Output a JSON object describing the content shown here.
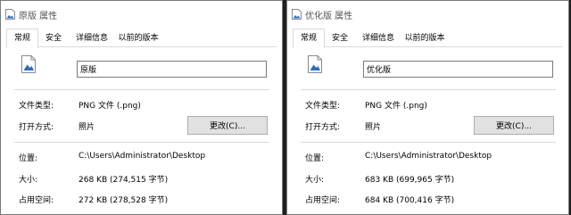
{
  "dialogs": [
    {
      "title": "原版 属性",
      "tabs": [
        "常规",
        "安全",
        "详细信息",
        "以前的版本"
      ],
      "file_name": "原版",
      "file_type_label": "文件类型:",
      "file_type_value": "PNG 文件 (.png)",
      "open_with_label": "打开方式:",
      "open_with_value": "照片",
      "change_button": "更改(C)...",
      "location_label": "位置:",
      "location_value": "C:\\Users\\Administrator\\Desktop",
      "size_label": "大小:",
      "size_value": "268 KB (274,515 字节)",
      "disk_label": "占用空间:",
      "disk_value": "272 KB (278,528 字节)"
    },
    {
      "title": "优化版 属性",
      "tabs": [
        "常规",
        "安全",
        "详细信息",
        "以前的版本"
      ],
      "file_name": "优化版",
      "file_type_label": "文件类型:",
      "file_type_value": "PNG 文件 (.png)",
      "open_with_label": "打开方式:",
      "open_with_value": "照片",
      "change_button": "更改(C)...",
      "location_label": "位置:",
      "location_value": "C:\\Users\\Administrator\\Desktop",
      "size_label": "大小:",
      "size_value": "683 KB (699,965 字节)",
      "disk_label": "占用空间:",
      "disk_value": "684 KB (700,416 字节)"
    }
  ],
  "colors": {
    "icon_blue": "#2b6cc4",
    "tab_border": "#d9d9d9",
    "button_bg": "#e1e1e1"
  },
  "icons": {
    "title": "image-file-icon",
    "file": "image-file-icon"
  }
}
